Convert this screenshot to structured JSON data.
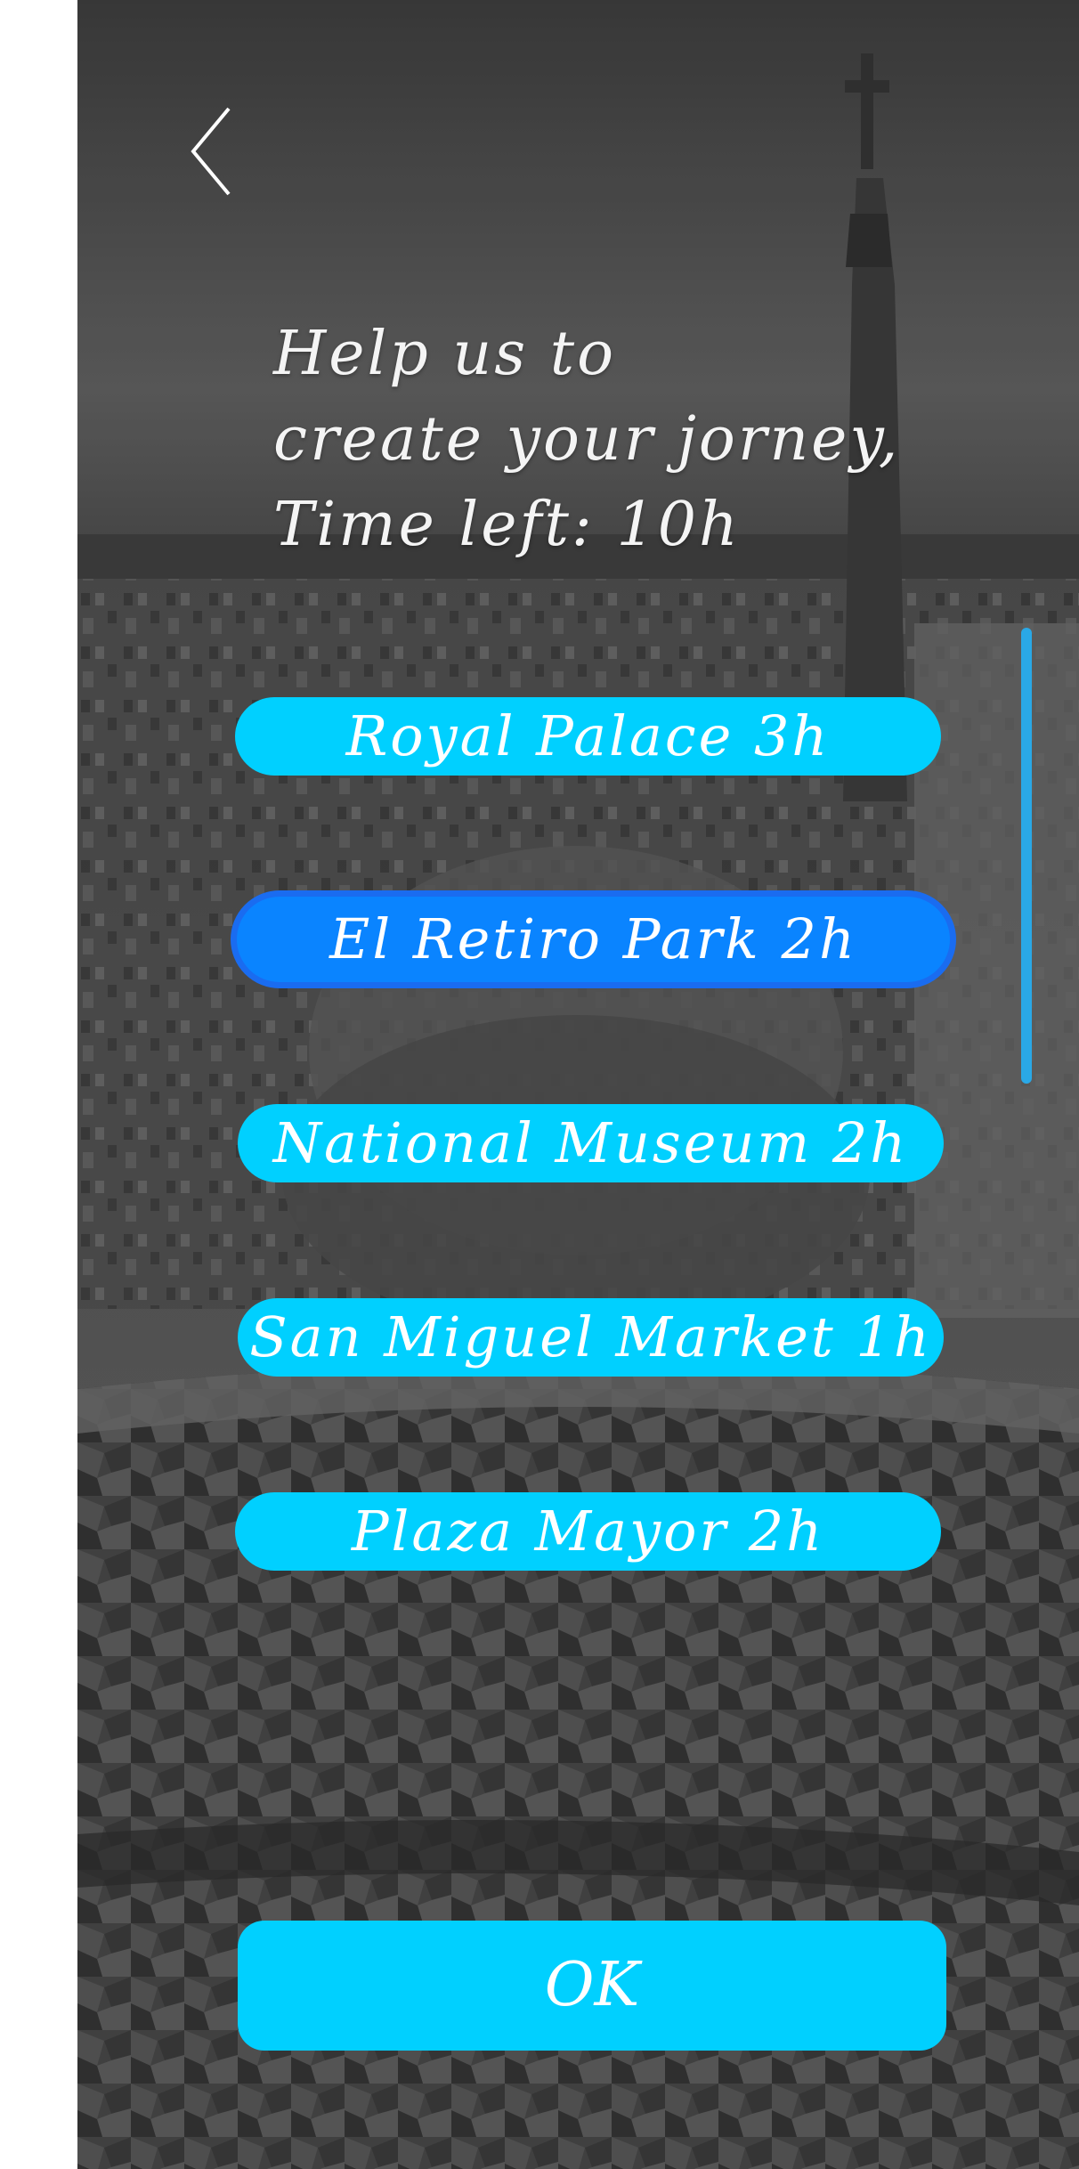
{
  "colors": {
    "pill": "#00d0ff",
    "pill_selected": "#0a84ff",
    "scrollbar": "#2aa8e6",
    "text": "#ffffff"
  },
  "nav": {
    "back_icon": "chevron-left-icon"
  },
  "heading": {
    "line1": "Help us to",
    "line2": "create your jorney,",
    "line3": "Time left: 10h"
  },
  "places": [
    {
      "label": "Royal Palace  3h",
      "selected": false
    },
    {
      "label": "El Retiro Park  2h",
      "selected": true
    },
    {
      "label": "National Museum 2h",
      "selected": false
    },
    {
      "label": "San Miguel Market 1h",
      "selected": false
    },
    {
      "label": "Plaza Mayor  2h",
      "selected": false
    }
  ],
  "ok_label": "OK"
}
